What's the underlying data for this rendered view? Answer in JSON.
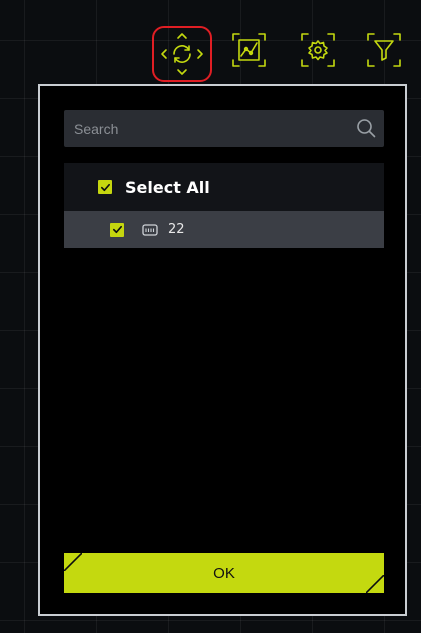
{
  "toolbar": {
    "buttons": [
      {
        "icon": "refresh-icon",
        "highlighted": true,
        "highlight_color": "#e01e24"
      },
      {
        "icon": "chart-icon"
      },
      {
        "icon": "settings-icon"
      },
      {
        "icon": "filter-icon"
      }
    ],
    "accent_color": "#c4d90f"
  },
  "panel": {
    "search": {
      "placeholder": "Search",
      "value": ""
    },
    "select_all": {
      "label": "Select All",
      "checked": true
    },
    "items": [
      {
        "label": "22",
        "checked": true,
        "icon": "device-icon"
      }
    ],
    "ok_label": "OK"
  }
}
